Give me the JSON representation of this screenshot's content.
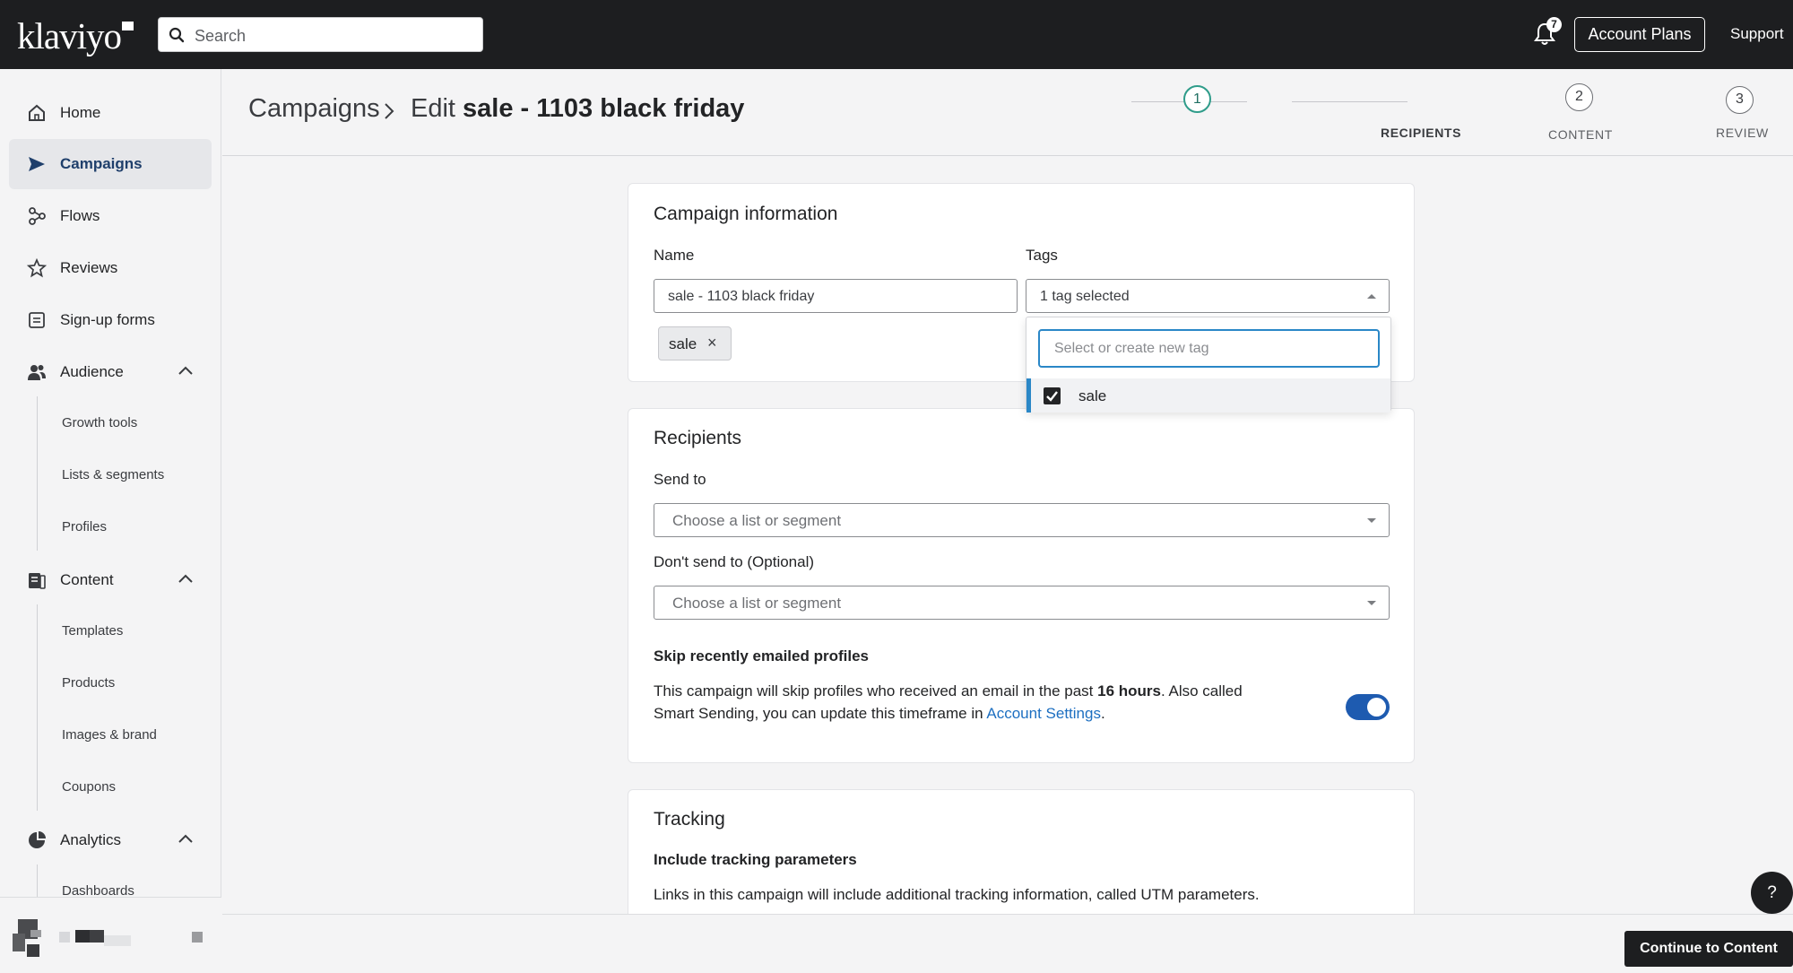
{
  "topbar": {
    "logo": "klaviyo",
    "search_placeholder": "Search",
    "notification_count": "7",
    "account_plans": "Account Plans",
    "support": "Support"
  },
  "sidebar": {
    "items": [
      {
        "label": "Home",
        "icon": "home-icon"
      },
      {
        "label": "Campaigns",
        "icon": "send-icon",
        "active": true
      },
      {
        "label": "Flows",
        "icon": "flows-icon"
      },
      {
        "label": "Reviews",
        "icon": "star-icon"
      },
      {
        "label": "Sign-up forms",
        "icon": "form-icon"
      },
      {
        "label": "Audience",
        "icon": "audience-icon",
        "expanded": true
      },
      {
        "label": "Content",
        "icon": "content-icon",
        "expanded": true
      },
      {
        "label": "Analytics",
        "icon": "analytics-icon",
        "expanded": true
      }
    ],
    "audience_sub": [
      "Growth tools",
      "Lists & segments",
      "Profiles"
    ],
    "content_sub": [
      "Templates",
      "Products",
      "Images & brand",
      "Coupons"
    ],
    "analytics_sub": [
      "Dashboards"
    ]
  },
  "header": {
    "breadcrumb_root": "Campaigns",
    "edit_prefix": "Edit",
    "campaign_name": "sale - 1103 black friday",
    "steps": [
      {
        "number": "1",
        "label": "RECIPIENTS",
        "active": true
      },
      {
        "number": "2",
        "label": "CONTENT"
      },
      {
        "number": "3",
        "label": "REVIEW"
      }
    ]
  },
  "campaign_info": {
    "title": "Campaign information",
    "name_label": "Name",
    "name_value": "sale - 1103 black friday",
    "tags_label": "Tags",
    "tags_value": "1 tag selected",
    "chip": "sale",
    "chip_remove": "×",
    "tag_search_placeholder": "Select or create new tag",
    "tag_options": [
      {
        "label": "sale",
        "checked": true
      }
    ]
  },
  "recipients": {
    "title": "Recipients",
    "send_to_label": "Send to",
    "send_to_placeholder": "Choose a list or segment",
    "dont_send_label": "Don't send to",
    "dont_send_optional": "(Optional)",
    "dont_send_placeholder": "Choose a list or segment",
    "skip_title": "Skip recently emailed profiles",
    "skip_text_1": "This campaign will skip profiles who received an email in the past ",
    "skip_hours": "16 hours",
    "skip_text_2": ". Also called",
    "skip_text_3": "Smart Sending, you can update this timeframe in ",
    "account_settings_link": "Account Settings",
    "skip_text_4": ".",
    "smart_sending_enabled": true
  },
  "tracking": {
    "title": "Tracking",
    "subtitle": "Include tracking parameters",
    "text": "Links in this campaign will include additional tracking information, called UTM parameters."
  },
  "footer": {
    "continue": "Continue to Content",
    "help": "?"
  },
  "colors": {
    "topbar": "#1d1e20",
    "accent_blue": "#2a87c7",
    "toggle_on": "#1e5bb0",
    "active_step": "#2f9c8a",
    "link": "#1d6fc1"
  }
}
